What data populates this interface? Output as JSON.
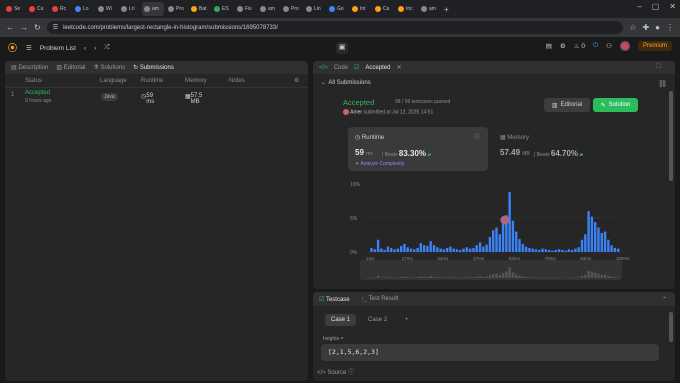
{
  "browser": {
    "tabs": [
      {
        "label": "Se",
        "color": "#e94235"
      },
      {
        "label": "Cu",
        "color": "#e94235"
      },
      {
        "label": "Rc",
        "color": "#e94235"
      },
      {
        "label": "Lo",
        "color": "#4285f4"
      },
      {
        "label": "Wi",
        "color": "#888888"
      },
      {
        "label": "Lri",
        "color": "#888888"
      },
      {
        "label": "am",
        "color": "#888888"
      },
      {
        "label": "Pro",
        "color": "#888888"
      },
      {
        "label": "Bat",
        "color": "#ffa116"
      },
      {
        "label": "ES",
        "color": "#34a853"
      },
      {
        "label": "Fis",
        "color": "#888888"
      },
      {
        "label": "am",
        "color": "#888888"
      },
      {
        "label": "Pro",
        "color": "#888888"
      },
      {
        "label": "Lin",
        "color": "#888888"
      },
      {
        "label": "Go",
        "color": "#4285f4"
      },
      {
        "label": "Int",
        "color": "#ffa116"
      },
      {
        "label": "Ca",
        "color": "#ffa116"
      },
      {
        "label": "Inc",
        "color": "#ffa116"
      },
      {
        "label": "am",
        "color": "#888888"
      }
    ],
    "url": "leetcode.com/problems/largest-rectangle-in-histogram/submissions/1695078733/"
  },
  "nav": {
    "problem_list": "Problem List",
    "streak": "0",
    "premium": "Premium"
  },
  "left": {
    "tabs": [
      "Description",
      "Editorial",
      "Solutions",
      "Submissions"
    ],
    "headers": {
      "status": "Status",
      "language": "Language",
      "runtime": "Runtime",
      "memory": "Memory",
      "notes": "Notes"
    },
    "row": {
      "index": "1",
      "status": "Accepted",
      "time": "9 hours ago",
      "language": "Java",
      "runtime": "59 ms",
      "memory": "57.5 MB"
    }
  },
  "right": {
    "tabs": [
      "Code",
      "Accepted"
    ],
    "all_submissions": "All Submissions",
    "accepted": "Accepted",
    "tests_passed": "98 / 99 testcases passed",
    "author": "Amer",
    "submitted": "submitted at Jul 12, 2025 14:51",
    "editorial_btn": "Editorial",
    "solution_btn": "Solution",
    "runtime": {
      "label": "Runtime",
      "value": "59",
      "unit": "ms",
      "beats_label": "Beats",
      "beats": "83.30%",
      "analyze": "Analyze Complexity"
    },
    "memory": {
      "label": "Memory",
      "value": "57.49",
      "unit": "MB",
      "beats_label": "Beats",
      "beats": "64.70%"
    }
  },
  "chart_data": {
    "type": "bar",
    "y_ticks": [
      "10%",
      "5%",
      "0%"
    ],
    "x_ticks": [
      "1ms",
      "17ms",
      "32ms",
      "47ms",
      "63ms",
      "78ms",
      "93ms",
      "108ms"
    ],
    "highlight_x": "59ms",
    "ylim": [
      0,
      10
    ],
    "values": [
      0.6,
      0.4,
      1.8,
      0.5,
      0.3,
      0.8,
      0.6,
      0.4,
      0.5,
      0.9,
      1.2,
      0.7,
      0.5,
      0.4,
      0.6,
      1.3,
      1.0,
      0.9,
      1.6,
      1.0,
      0.7,
      0.5,
      0.4,
      0.6,
      0.8,
      0.5,
      0.4,
      0.3,
      0.5,
      0.7,
      0.5,
      0.6,
      1.0,
      1.4,
      0.8,
      1.1,
      2.2,
      3.2,
      3.6,
      2.6,
      4.2,
      5.4,
      8.8,
      4.6,
      3.0,
      1.9,
      1.2,
      0.8,
      0.6,
      0.5,
      0.4,
      0.3,
      0.5,
      0.4,
      0.3,
      0.2,
      0.3,
      0.4,
      0.3,
      0.2,
      0.4,
      0.3,
      0.5,
      0.7,
      1.8,
      2.6,
      6.0,
      5.2,
      4.4,
      3.6,
      2.8,
      3.0,
      1.8,
      1.0,
      0.6,
      0.5
    ]
  },
  "testcase": {
    "tabs": [
      "Testcase",
      "Test Result"
    ],
    "cases": [
      "Case 1",
      "Case 2"
    ],
    "add": "+",
    "label": "heights =",
    "value": "[2,1,5,6,2,3]",
    "source": "Source"
  }
}
